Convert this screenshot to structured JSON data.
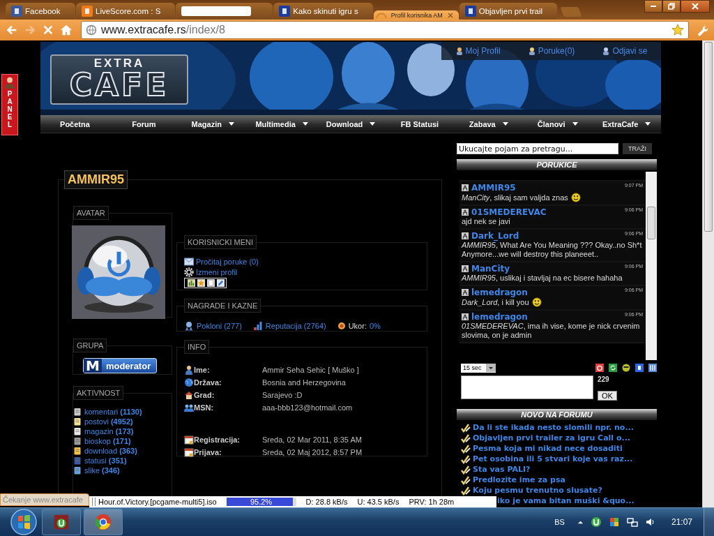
{
  "browser": {
    "tabs": [
      {
        "kind": "social",
        "title": "Facebook",
        "selected": false,
        "loading": false
      },
      {
        "kind": "sport",
        "title": "LiveScore.com : S",
        "selected": false,
        "loading": false
      },
      {
        "kind": "redacted",
        "selected": false,
        "loading": false
      },
      {
        "kind": "site",
        "title": "Kako skinuti igru s",
        "selected": false,
        "loading": false
      },
      {
        "kind": "site",
        "title": "Profil korisnika AM",
        "selected": true,
        "loading": true
      },
      {
        "kind": "site",
        "title": "Objavljen prvi trail",
        "selected": false,
        "loading": false
      }
    ],
    "url_host": "www.extracafe.rs",
    "url_path": "/index/8"
  },
  "site": {
    "logo_top": "EXTRA",
    "logo_main": "CAFE",
    "side_tab": "PANEL",
    "user_links": [
      "Moj Profil",
      "Poruke(0)",
      "Odjavi se"
    ],
    "nav": [
      {
        "label": "Početna",
        "dropdown": false
      },
      {
        "label": "Forum",
        "dropdown": false
      },
      {
        "label": "Magazin",
        "dropdown": true
      },
      {
        "label": "Multimedia",
        "dropdown": true
      },
      {
        "label": "Download",
        "dropdown": true
      },
      {
        "label": "FB Statusi",
        "dropdown": false
      },
      {
        "label": "Zabava",
        "dropdown": true
      },
      {
        "label": "Članovi",
        "dropdown": true
      },
      {
        "label": "ExtraCafe",
        "dropdown": true
      }
    ]
  },
  "profile": {
    "username": "AMMIR95",
    "avatar_title": "AVATAR",
    "group_title": "GRUPA",
    "group_badge_letter": "M",
    "group_badge": "moderator",
    "activity_title": "AKTIVNOST",
    "activity": [
      {
        "label": "komentari",
        "count": "(1130)"
      },
      {
        "label": "postovi",
        "count": "(4952)"
      },
      {
        "label": "magazin",
        "count": "(173)"
      },
      {
        "label": "bioskop",
        "count": "(171)"
      },
      {
        "label": "download",
        "count": "(363)"
      },
      {
        "label": "statusi",
        "count": "(351)"
      },
      {
        "label": "slike",
        "count": "(346)"
      }
    ],
    "menu_title": "KORISNICKI MENI",
    "menu": [
      "Pročitaj poruke (0)",
      "Izmeni profil"
    ],
    "awards_title": "NAGRADE I KAZNE",
    "awards": [
      {
        "label": "Pokloni",
        "count": "(277)"
      },
      {
        "label": "Reputacija",
        "count": "(2764)"
      }
    ],
    "warning_label": "Ukor:",
    "warning_value": "0%",
    "info_title": "INFO",
    "info": [
      {
        "label": "Ime:",
        "value": "Ammir Seha Sehic [ Muško ]"
      },
      {
        "label": "Država:",
        "value": "Bosnia and Herzegovina"
      },
      {
        "label": "Grad:",
        "value": "Sarajevo :D"
      },
      {
        "label": "MSN:",
        "value": "aaa-bbb123@hotmail.com"
      }
    ],
    "dates": [
      {
        "label": "Registracija:",
        "value": "Sreda, 02 Mar 2011, 8:35 AM"
      },
      {
        "label": "Prijava:",
        "value": "Sreda, 02 Maj 2012, 8:57 PM"
      }
    ]
  },
  "sidebar": {
    "search_placeholder": "Ukucajte pojam za pretragu...",
    "search_button": "TRAŽI",
    "chat_title": "PORUKICE",
    "messages": [
      {
        "user": "AMMIR95",
        "time": "9:07 PM",
        "text": "*ManCity*, slikaj sam valjda znas",
        "smiley": true
      },
      {
        "user": "01SMEDEREVAC",
        "time": "9:06 PM",
        "text": "ajd nek se javi",
        "smiley": false
      },
      {
        "user": "Dark_Lord",
        "time": "9:06 PM",
        "text": "*AMMIR95*, What Are You Meaning ??? Okay..no Sh*t Anymore...we will destroy this planeeet..",
        "smiley": false
      },
      {
        "user": "ManCity",
        "time": "9:06 PM",
        "text": "*AMMIR95*, uslikaj i stavljaj na ec bisere hahaha",
        "smiley": false
      },
      {
        "user": "lemedragon",
        "time": "9:06 PM",
        "text": "*Dark_Lord*, i kill you",
        "smiley": true
      },
      {
        "user": "lemedragon",
        "time": "9:06 PM",
        "text": "*01SMEDEREVAC*, ima ih vise, kome je nick crvenim slovima, on je admin",
        "smiley": false
      }
    ],
    "refresh": "15 sec",
    "char_count": "229",
    "send_button": "OK",
    "forum_title": "NOVO NA FORUMU",
    "forum": [
      "Da li ste ikada nesto slomili npr. no...",
      "Objavljen prvi trailer za igru Call o...",
      "Pesma koja mi nikad nece dosaditi",
      "Pet osobina ili 5 stvari koje vas raz...",
      "Sta vas PALI?",
      "Predlozite ime za psa",
      "Koju pesmu trenutno slusate?"
    ],
    "forum_covered_item": "iko je vama bitan muški &quo..."
  },
  "status": "Čekanje www.extracafe",
  "torrent": {
    "name": "Hour.of.Victory.[pcgame-multi5].iso",
    "level": 0.952,
    "percent": "95.2%",
    "down": "D: 28.8 kB/s",
    "up": "U: 43.5 kB/s",
    "eta": "PRV: 1h 28m"
  },
  "taskbar": {
    "language": "BS",
    "time": "21:07"
  }
}
